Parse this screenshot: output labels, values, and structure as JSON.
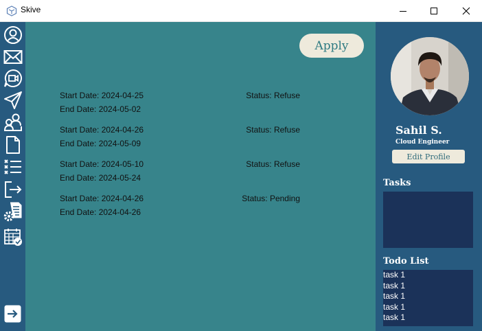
{
  "window": {
    "title": "Skive"
  },
  "main": {
    "apply_label": "Apply",
    "leaves": [
      {
        "start": "Start Date: 2024-04-25",
        "end": "End Date: 2024-05-02",
        "status": "Status: Refuse"
      },
      {
        "start": "Start Date: 2024-04-26",
        "end": "End Date: 2024-05-09",
        "status": "Status: Refuse"
      },
      {
        "start": "Start Date: 2024-05-10",
        "end": "End Date: 2024-05-24",
        "status": "Status: Refuse"
      },
      {
        "start": "Start Date: 2024-04-26",
        "end": "End Date: 2024-04-26",
        "status": "Status: Pending"
      }
    ]
  },
  "sidebar": {
    "icons": [
      "profile-icon",
      "mail-icon",
      "video-chat-icon",
      "send-icon",
      "users-icon",
      "document-icon",
      "task-list-icon",
      "logout-icon",
      "settings-document-icon",
      "calendar-check-icon"
    ],
    "bottom_icon": "expand-arrow-icon"
  },
  "profile": {
    "name": "Sahil S.",
    "role": "Cloud Engineer",
    "edit_label": "Edit Profile",
    "tasks_title": "Tasks",
    "todo_title": "Todo List",
    "todo_items": [
      "task 1",
      "task 1",
      "task 1",
      "task 1",
      "task 1"
    ]
  },
  "colors": {
    "sidebar": "#275a7f",
    "main": "#37848b",
    "panel_box": "#1b3259",
    "button_bg": "#eeeadc"
  }
}
